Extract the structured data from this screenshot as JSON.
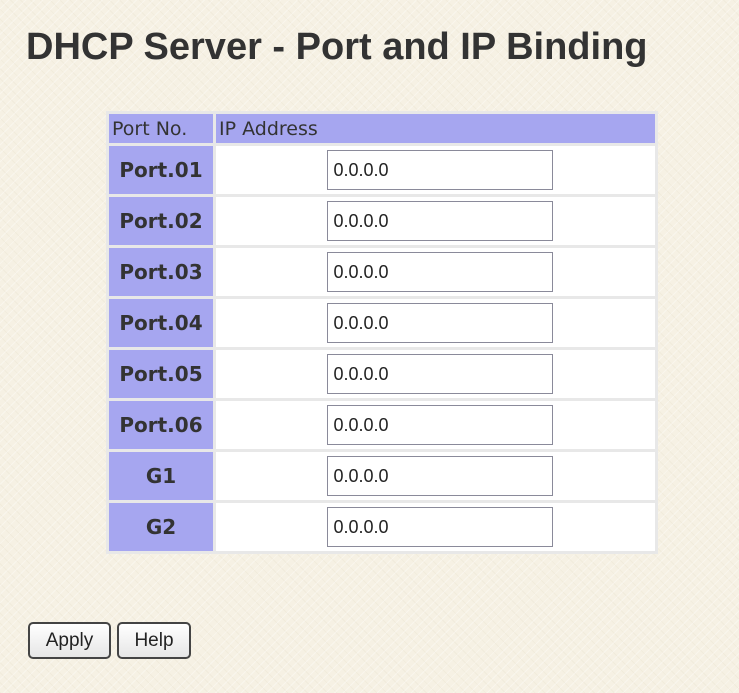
{
  "page": {
    "title": "DHCP Server - Port and IP Binding"
  },
  "table": {
    "headers": {
      "port": "Port No.",
      "ip": "IP Address"
    },
    "rows": [
      {
        "port": "Port.01",
        "ip": "0.0.0.0"
      },
      {
        "port": "Port.02",
        "ip": "0.0.0.0"
      },
      {
        "port": "Port.03",
        "ip": "0.0.0.0"
      },
      {
        "port": "Port.04",
        "ip": "0.0.0.0"
      },
      {
        "port": "Port.05",
        "ip": "0.0.0.0"
      },
      {
        "port": "Port.06",
        "ip": "0.0.0.0"
      },
      {
        "port": "G1",
        "ip": "0.0.0.0"
      },
      {
        "port": "G2",
        "ip": "0.0.0.0"
      }
    ]
  },
  "buttons": {
    "apply": "Apply",
    "help": "Help"
  },
  "colors": {
    "header_bg": "#a6a6f0",
    "title_text": "#333333",
    "page_bg": "#f6f1e4"
  }
}
